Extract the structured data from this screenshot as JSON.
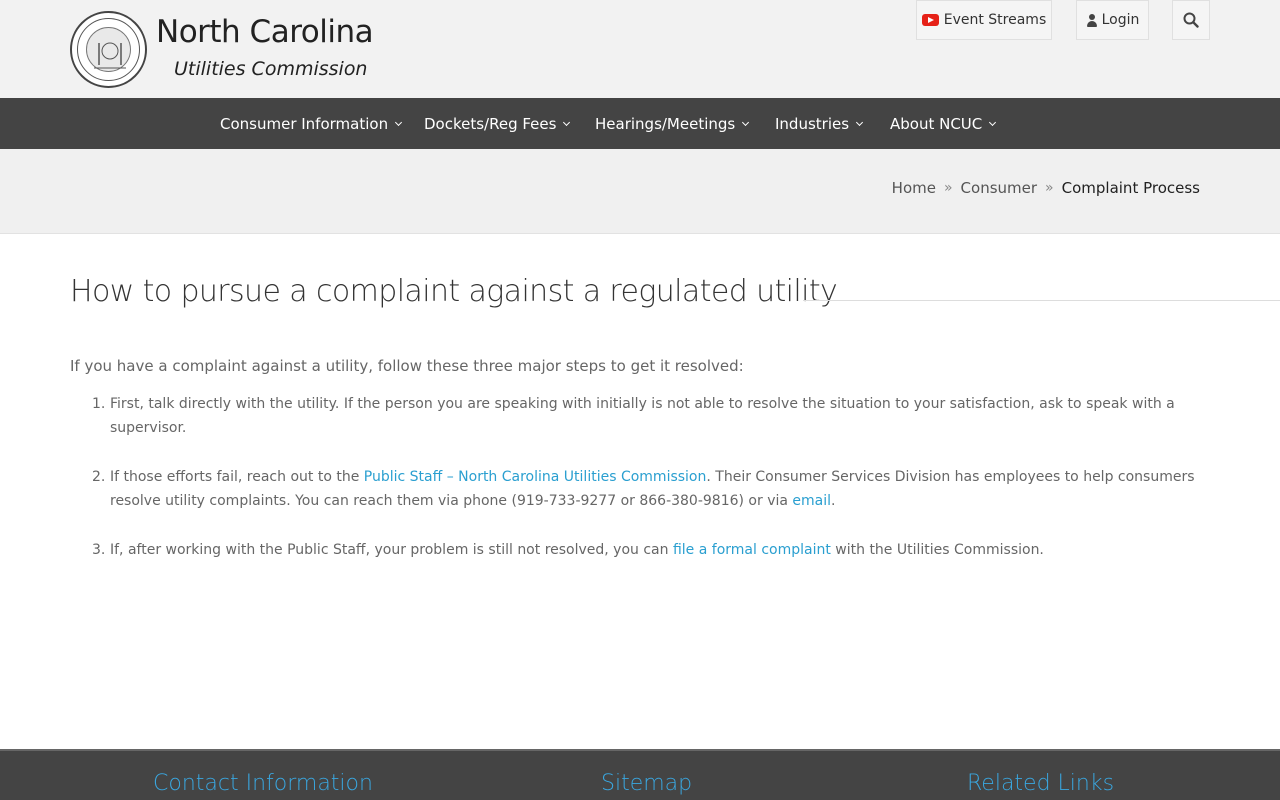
{
  "header": {
    "brand_title": "North Carolina",
    "brand_subtitle": "Utilities Commission",
    "event_streams_label": "Event Streams",
    "login_label": "Login"
  },
  "nav": {
    "items": [
      {
        "label": "Consumer Information"
      },
      {
        "label": "Dockets/Reg Fees"
      },
      {
        "label": "Hearings/Meetings"
      },
      {
        "label": "Industries"
      },
      {
        "label": "About NCUC"
      }
    ]
  },
  "breadcrumb": {
    "home": "Home",
    "separator": "»",
    "consumer": "Consumer",
    "current": "Complaint Process"
  },
  "main": {
    "title": "How to pursue a complaint against a regulated utility",
    "intro": "If you have a complaint against a utility, follow these three major steps to get it resolved:",
    "steps": [
      {
        "num": "1.",
        "text": "First, talk directly with the utility. If the person you are speaking with initially is not able to resolve the situation to your satisfaction, ask to speak with a supervisor."
      },
      {
        "num": "2.",
        "text_before": "If those efforts fail, reach out to the ",
        "link1": "Public Staff – North Carolina Utilities Commission",
        "text_middle": ". Their Consumer Services Division has employees to help consumers resolve utility complaints. You can reach them via phone (919-733-9277 or 866-380-9816) or via ",
        "link2": "email",
        "text_after": "."
      },
      {
        "num": "3.",
        "text_before": "If, after working with the Public Staff, your problem is still not resolved, you can ",
        "link": "file a formal complaint",
        "text_after": " with the Utilities Commission."
      }
    ]
  },
  "footer": {
    "contact_heading": "Contact Information",
    "sitemap_heading": "Sitemap",
    "related_heading": "Related Links"
  },
  "colors": {
    "nav_bg": "#444444",
    "link": "#2a9fd0",
    "footer_heading": "#3aa7e0",
    "youtube_red": "#e62117"
  }
}
